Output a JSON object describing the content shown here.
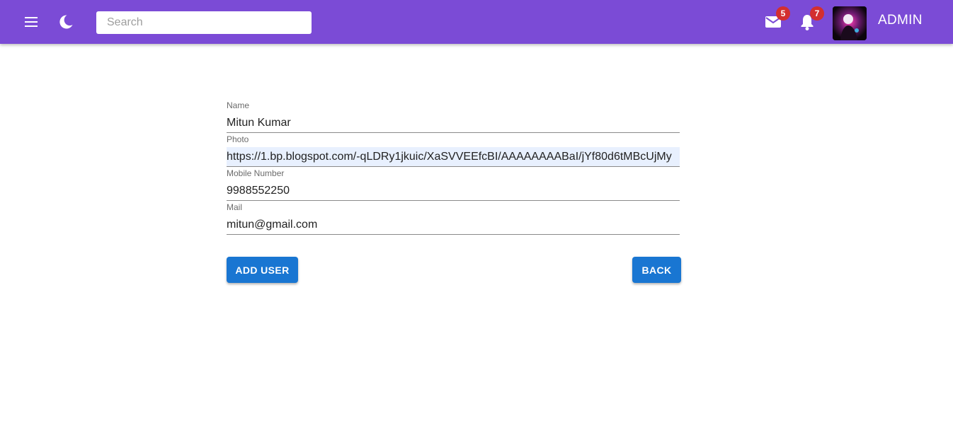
{
  "header": {
    "background_color": "#7b4bd6",
    "menu_icon": "hamburger-menu-icon",
    "theme_icon": "moon-icon",
    "search": {
      "placeholder": "Search",
      "value": ""
    },
    "mail": {
      "icon": "mail-icon",
      "badge": "5"
    },
    "notifications": {
      "icon": "bell-icon",
      "badge": "7"
    },
    "badge_color": "#d32f2f",
    "user_label": "ADMIN"
  },
  "form": {
    "fields": [
      {
        "label": "Name",
        "value": "Mitun Kumar"
      },
      {
        "label": "Photo",
        "value": "https://1.bp.blogspot.com/-qLDRy1jkuic/XaSVVEEfcBI/AAAAAAAABaI/jYf80d6tMBcUjMy"
      },
      {
        "label": "Mobile Number",
        "value": "9988552250"
      },
      {
        "label": "Mail",
        "value": "mitun@gmail.com"
      }
    ],
    "add_button": "ADD USER",
    "back_button": "BACK",
    "button_color": "#1976d2"
  }
}
